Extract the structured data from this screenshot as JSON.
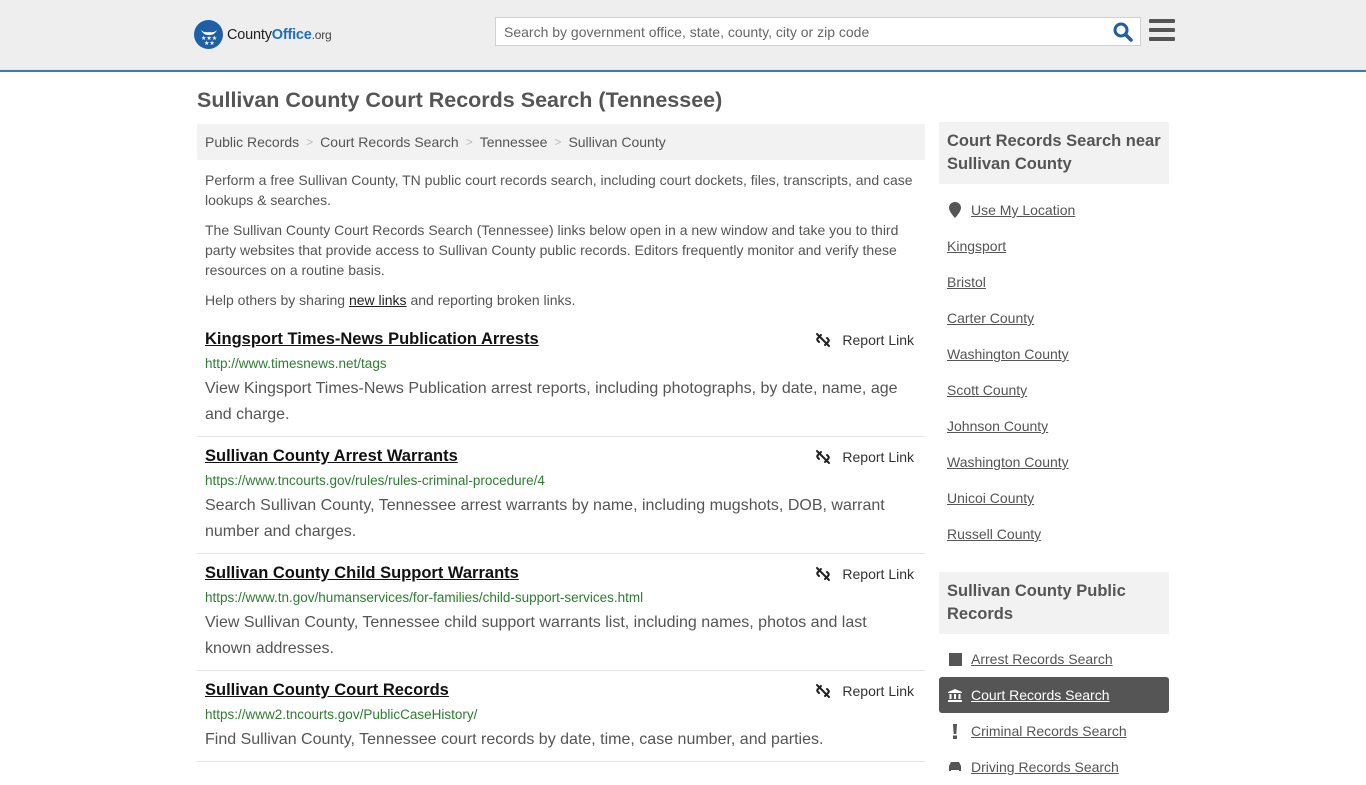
{
  "header": {
    "logo": {
      "text_main": "County",
      "text_accent": "Office",
      "text_suffix": ".org"
    },
    "search": {
      "placeholder": "Search by government office, state, county, city or zip code",
      "value": ""
    },
    "colors": {
      "brand": "#1f5fa8",
      "header_border": "#3a7bb0",
      "header_bg": "#eeeeee"
    }
  },
  "page": {
    "title": "Sullivan County Court Records Search (Tennessee)"
  },
  "breadcrumb": [
    "Public Records",
    "Court Records Search",
    "Tennessee",
    "Sullivan County"
  ],
  "intro": {
    "p1": "Perform a free Sullivan County, TN public court records search, including court dockets, files, transcripts, and case lookups & searches.",
    "p2": "The Sullivan County Court Records Search (Tennessee) links below open in a new window and take you to third party websites that provide access to Sullivan County public records. Editors frequently monitor and verify these resources on a routine basis.",
    "p3_before": "Help others by sharing ",
    "p3_link": "new links",
    "p3_after": " and reporting broken links."
  },
  "listings": [
    {
      "title": "Kingsport Times-News Publication Arrests",
      "url": "http://www.timesnews.net/tags",
      "description": "View Kingsport Times-News Publication arrest reports, including photographs, by date, name, age and charge.",
      "report_label": "Report Link"
    },
    {
      "title": "Sullivan County Arrest Warrants",
      "url": "https://www.tncourts.gov/rules/rules-criminal-procedure/4",
      "description": "Search Sullivan County, Tennessee arrest warrants by name, including mugshots, DOB, warrant number and charges.",
      "report_label": "Report Link"
    },
    {
      "title": "Sullivan County Child Support Warrants",
      "url": "https://www.tn.gov/humanservices/for-families/child-support-services.html",
      "description": "View Sullivan County, Tennessee child support warrants list, including names, photos and last known addresses.",
      "report_label": "Report Link"
    },
    {
      "title": "Sullivan County Court Records",
      "url": "https://www2.tncourts.gov/PublicCaseHistory/",
      "description": "Find Sullivan County, Tennessee court records by date, time, case number, and parties.",
      "report_label": "Report Link"
    }
  ],
  "sidebar": {
    "nearby": {
      "heading": "Court Records Search near Sullivan County",
      "use_location": "Use My Location",
      "items": [
        "Kingsport",
        "Bristol",
        "Carter County",
        "Washington County",
        "Scott County",
        "Johnson County",
        "Washington County",
        "Unicoi County",
        "Russell County"
      ]
    },
    "public_records": {
      "heading": "Sullivan County Public Records",
      "items": [
        {
          "label": "Arrest Records Search",
          "icon": "square-icon",
          "active": false
        },
        {
          "label": "Court Records Search",
          "icon": "courthouse-icon",
          "active": true
        },
        {
          "label": "Criminal Records Search",
          "icon": "exclamation-icon",
          "active": false
        },
        {
          "label": "Driving Records Search",
          "icon": "car-icon",
          "active": false
        }
      ]
    }
  }
}
